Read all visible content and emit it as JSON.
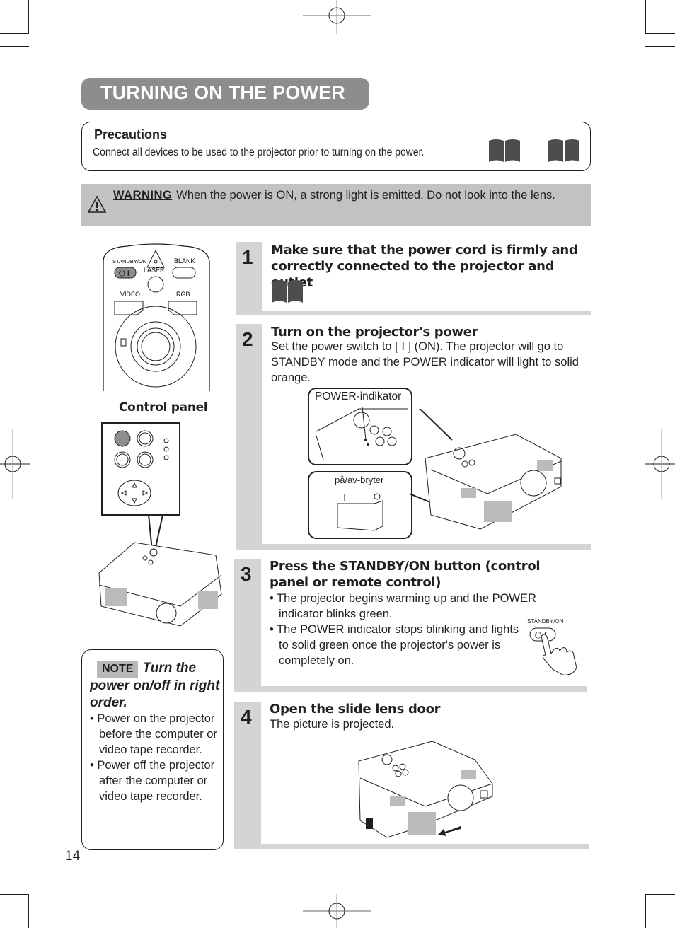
{
  "page": {
    "title": "TURNING ON THE POWER",
    "page_number": "14"
  },
  "precautions": {
    "title": "Precautions",
    "text": "Connect all devices to be used to the projector prior to turning on the power.",
    "icons": [
      "book-icon",
      "book-icon"
    ]
  },
  "warning": {
    "label": "WARNING",
    "text": "When the power is ON, a strong light is emitted. Do not look into the lens.",
    "icon": "warning-triangle-icon"
  },
  "remote": {
    "buttons": [
      "STANDBY/ON",
      "LASER",
      "BLANK",
      "VIDEO",
      "RGB"
    ],
    "label": "Control panel"
  },
  "steps": [
    {
      "number": "1",
      "heading": "Make sure that the power cord is firmly and correctly connected to the projector and outlet",
      "icon": "book-icon"
    },
    {
      "number": "2",
      "heading": "Turn on the projector's power",
      "body": "Set the power switch to [ I ] (ON). The projector will go to STANDBY mode and the POWER indicator will light to solid orange.",
      "callouts": [
        "POWER-indikator",
        "på/av-bryter"
      ]
    },
    {
      "number": "3",
      "heading": "Press the STANDBY/ON button (control panel or remote control)",
      "bullets": [
        "The projector begins warming up and the POWER indicator blinks green.",
        "The POWER indicator stops blinking and lights to solid green once the projector's power is completely on."
      ],
      "button_label": "STANDBY/ON"
    },
    {
      "number": "4",
      "heading": "Open the slide lens door",
      "body": "The picture is projected."
    }
  ],
  "note": {
    "badge": "NOTE",
    "heading": "Turn the power on/off in right order.",
    "bullets": [
      "Power on the projector before the computer or video tape recorder.",
      "Power off the projector after the computer or video tape recorder."
    ]
  }
}
